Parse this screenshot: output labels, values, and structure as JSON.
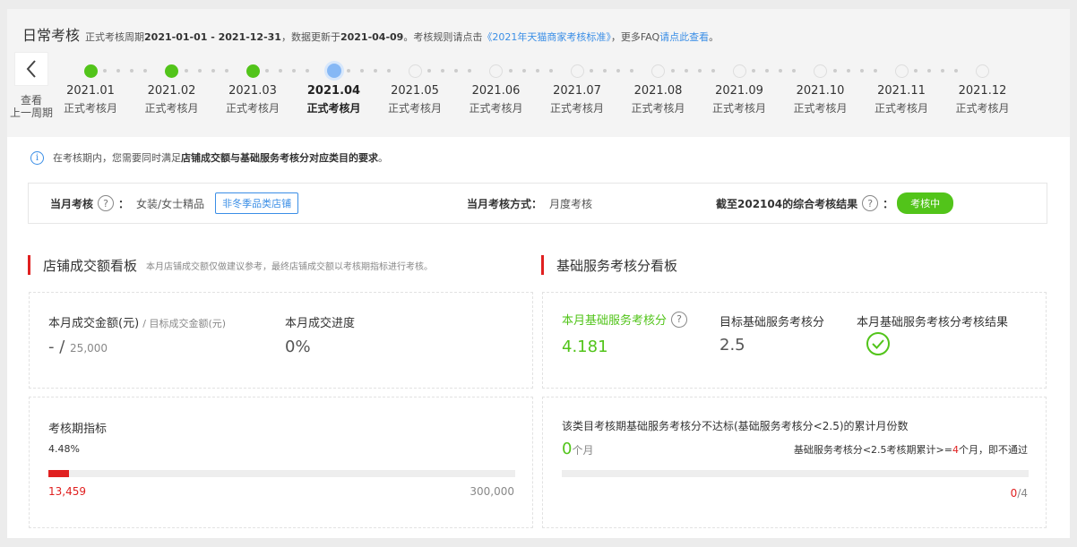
{
  "header": {
    "title": "日常考核",
    "period_prefix": "正式考核周期",
    "period_range": "2021-01-01 - 2021-12-31",
    "update_prefix": "，数据更新于",
    "update_date": "2021-04-09",
    "rules_prefix": "。考核规则请点击",
    "rules_link": "《2021年天猫商家考核标准》",
    "faq_prefix": "，更多FAQ",
    "faq_link": "请点此查看",
    "faq_suffix": "。"
  },
  "prev_period": {
    "label_line1": "查看",
    "label_line2": "上一周期"
  },
  "timeline": [
    {
      "month": "2021.01",
      "label": "正式考核月",
      "status": "done"
    },
    {
      "month": "2021.02",
      "label": "正式考核月",
      "status": "done"
    },
    {
      "month": "2021.03",
      "label": "正式考核月",
      "status": "done"
    },
    {
      "month": "2021.04",
      "label": "正式考核月",
      "status": "current"
    },
    {
      "month": "2021.05",
      "label": "正式考核月",
      "status": "future"
    },
    {
      "month": "2021.06",
      "label": "正式考核月",
      "status": "future"
    },
    {
      "month": "2021.07",
      "label": "正式考核月",
      "status": "future"
    },
    {
      "month": "2021.08",
      "label": "正式考核月",
      "status": "future"
    },
    {
      "month": "2021.09",
      "label": "正式考核月",
      "status": "future"
    },
    {
      "month": "2021.10",
      "label": "正式考核月",
      "status": "future"
    },
    {
      "month": "2021.11",
      "label": "正式考核月",
      "status": "future"
    },
    {
      "month": "2021.12",
      "label": "正式考核月",
      "status": "future"
    }
  ],
  "notice": {
    "icon": "info-icon",
    "prefix": "在考核期内，您需要同时满足",
    "bold": "店铺成交额与基础服务考核分对应类目的要求",
    "suffix": "。"
  },
  "summary": {
    "monthly_label": "当月考核",
    "colon": "：",
    "category": "女装/女士精品",
    "tag": "非冬季品类店铺",
    "method_label": "当月考核方式：",
    "method_value": "月度考核",
    "result_label": "截至202104的综合考核结果",
    "result_value": "考核中"
  },
  "sales": {
    "title": "店铺成交额看板",
    "subtitle": "本月店铺成交额仅做建议参考，最终店铺成交额以考核期指标进行考核。",
    "amount_label": "本月成交金额(元)",
    "target_label": "/ 目标成交金额(元)",
    "amount_value": "-",
    "slash": "/",
    "target_value": "25,000",
    "progress_label": "本月成交进度",
    "progress_value": "0%",
    "period_label": "考核期指标",
    "period_percent": "4.48%",
    "period_fraction": 0.0448,
    "period_current": "13,459",
    "period_target": "300,000"
  },
  "service": {
    "title": "基础服务考核分看板",
    "score_label": "本月基础服务考核分",
    "score_value": "4.181",
    "target_label": "目标基础服务考核分",
    "target_value": "2.5",
    "result_label": "本月基础服务考核分考核结果",
    "result_icon": "check-circle-icon",
    "fail_label": "该类目考核期基础服务考核分不达标(基础服务考核分<2.5)的累计月份数",
    "fail_count": "0",
    "fail_unit": "个月",
    "rule_prefix": "基础服务考核分<2.5考核期累计>=",
    "rule_limit": "4",
    "rule_suffix": "个月，即不通过",
    "progress_current": "0",
    "progress_total": "/4",
    "progress_fraction": 0
  },
  "colors": {
    "accent_green": "#52c41a",
    "accent_red": "#e02020",
    "link_blue": "#3a8ee6"
  }
}
